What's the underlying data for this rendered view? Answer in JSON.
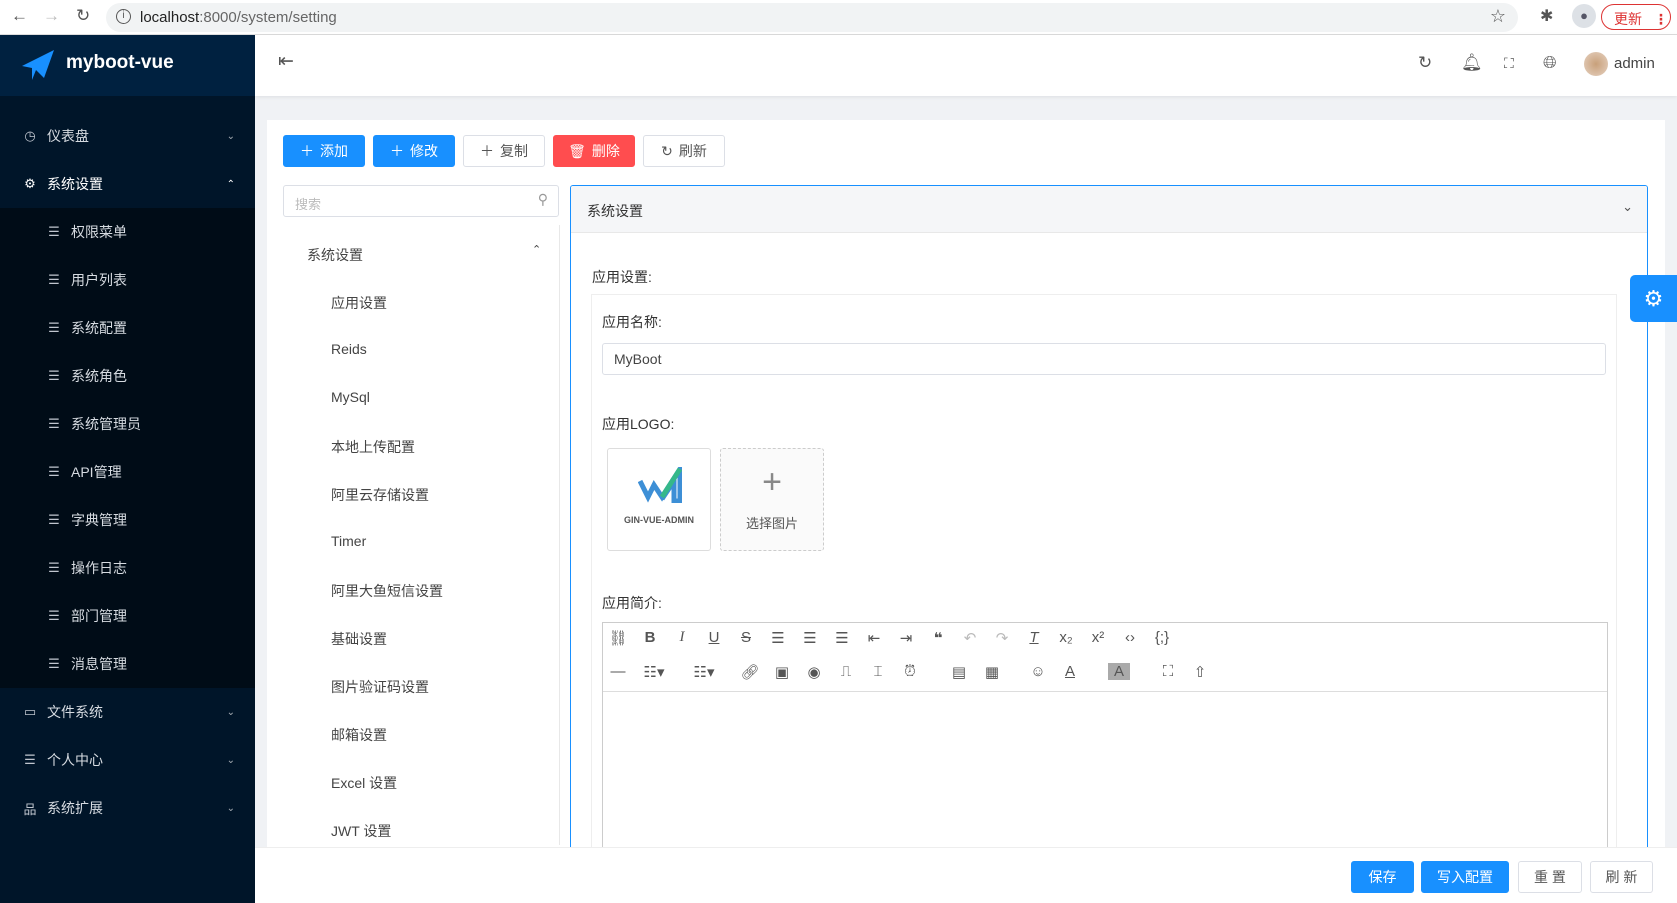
{
  "browser": {
    "url_host": "localhost",
    "url_path": ":8000/system/setting",
    "update_label": "更新"
  },
  "app": {
    "name": "myboot-vue",
    "user": "admin"
  },
  "sidebar": {
    "items": [
      {
        "label": "仪表盘",
        "icon": "dashboard-icon"
      },
      {
        "label": "系统设置",
        "icon": "gear-icon",
        "expanded": true
      },
      {
        "label": "权限菜单"
      },
      {
        "label": "用户列表"
      },
      {
        "label": "系统配置"
      },
      {
        "label": "系统角色"
      },
      {
        "label": "系统管理员"
      },
      {
        "label": "API管理"
      },
      {
        "label": "字典管理"
      },
      {
        "label": "操作日志"
      },
      {
        "label": "部门管理"
      },
      {
        "label": "消息管理"
      },
      {
        "label": "文件系统",
        "icon": "folder-icon"
      },
      {
        "label": "个人中心",
        "icon": "menu-icon"
      },
      {
        "label": "系统扩展",
        "icon": "sitemap-icon"
      }
    ]
  },
  "toolbar": {
    "add": "添加",
    "edit": "修改",
    "copy": "复制",
    "delete": "删除",
    "refresh": "刷新"
  },
  "search": {
    "placeholder": "搜索"
  },
  "tree": {
    "root": "系统设置",
    "items": [
      "应用设置",
      "Reids",
      "MySql",
      "本地上传配置",
      "阿里云存储设置",
      "Timer",
      "阿里大鱼短信设置",
      "基础设置",
      "图片验证码设置",
      "邮箱设置",
      "Excel 设置",
      "JWT 设置"
    ]
  },
  "panel": {
    "title": "系统设置",
    "section": "应用设置:",
    "name_label": "应用名称:",
    "name_value": "MyBoot",
    "logo_label": "应用LOGO:",
    "logo_text": "GIN-VUE-ADMIN",
    "choose_image": "选择图片",
    "intro_label": "应用简介:"
  },
  "footer": {
    "save": "保存",
    "write": "写入配置",
    "reset": "重 置",
    "refresh": "刷 新"
  }
}
